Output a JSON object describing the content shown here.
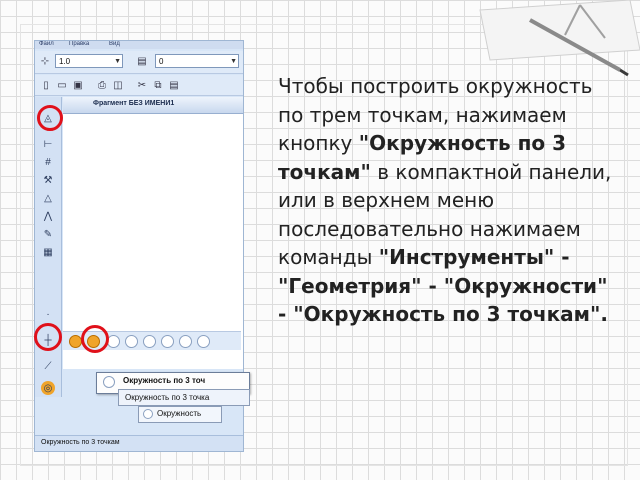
{
  "window": {
    "menu": [
      "Файл",
      "Правка",
      "Вид"
    ],
    "line_style_value": "1.0",
    "layer_value": "0",
    "document_title": "Фрагмент БЕЗ ИМЕНИ1",
    "status_text": "Окружность по 3 точкам"
  },
  "popups": {
    "item1": "Окружность по 3 точ",
    "item2": "Окружность по 3 точка",
    "item3": "Окружность"
  },
  "caption": {
    "p1": "Чтобы построить окружность по трем точкам, нажимаем кнопку ",
    "b1": "\"Окружность по 3 точкам\"",
    "p2": " в компактной панели, или в верхнем меню последовательно нажимаем команды ",
    "b2": "\"Инструменты\" - \"Геометрия\" - \"Окружности\" - \"Окружность по 3 точкам\"."
  },
  "colors": {
    "highlight": "#e0101a",
    "accent": "#f0a42a"
  },
  "icons": [
    "geometry-icon",
    "circle-3-points-icon",
    "save-icon",
    "open-icon",
    "new-icon",
    "print-icon"
  ]
}
